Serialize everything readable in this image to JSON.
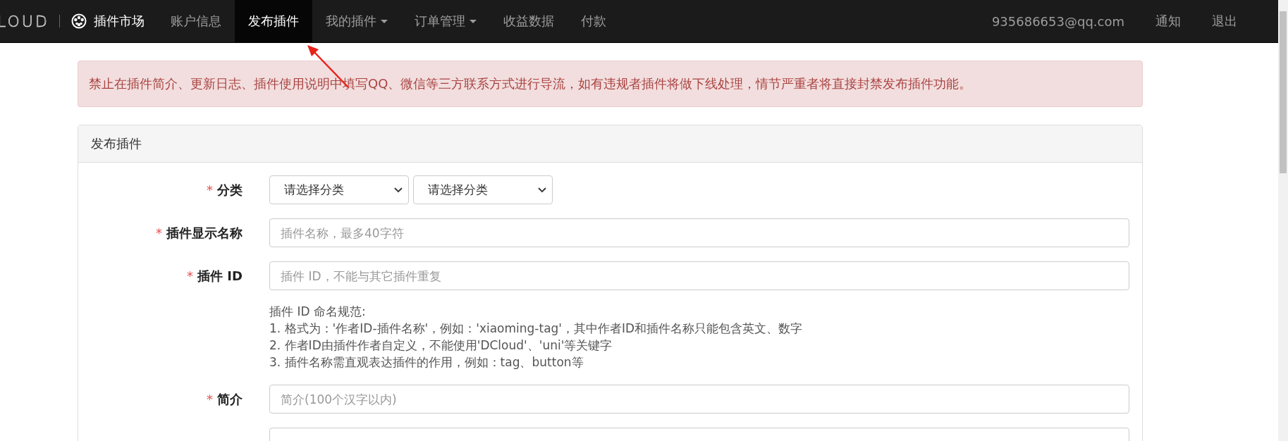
{
  "navbar": {
    "brand": "LOUD",
    "market": "插件市场",
    "items": [
      {
        "label": "账户信息",
        "selected": false,
        "dropdown": false
      },
      {
        "label": "发布插件",
        "selected": true,
        "dropdown": false
      },
      {
        "label": "我的插件",
        "selected": false,
        "dropdown": true
      },
      {
        "label": "订单管理",
        "selected": false,
        "dropdown": true
      },
      {
        "label": "收益数据",
        "selected": false,
        "dropdown": false
      },
      {
        "label": "付款",
        "selected": false,
        "dropdown": false
      }
    ],
    "right": [
      "935686653@qq.com",
      "通知",
      "退出"
    ]
  },
  "alert": "禁止在插件简介、更新日志、插件使用说明中填写QQ、微信等三方联系方式进行导流，如有违规者插件将做下线处理，情节严重者将直接封禁发布插件功能。",
  "panel": {
    "title": "发布插件",
    "fields": [
      {
        "kind": "selects",
        "label": "分类",
        "required": "*",
        "options": [
          "请选择分类",
          "请选择分类"
        ]
      },
      {
        "kind": "input",
        "label": "插件显示名称",
        "required": "*",
        "placeholder": "插件名称，最多40字符"
      },
      {
        "kind": "input",
        "label": "插件 ID",
        "required": "*",
        "placeholder": "插件 ID，不能与其它插件重复",
        "help": [
          "插件 ID 命名规范:",
          "1. 格式为：'作者ID-插件名称'，例如：'xiaoming-tag'，其中作者ID和插件名称只能包含英文、数字",
          "2. 作者ID由插件作者自定义，不能使用'DCloud'、'uni'等关键字",
          "3. 插件名称需直观表达插件的作用，例如：tag、button等"
        ]
      },
      {
        "kind": "input",
        "label": "简介",
        "required": "*",
        "placeholder": "简介(100个汉字以内)"
      },
      {
        "kind": "partial"
      }
    ]
  }
}
